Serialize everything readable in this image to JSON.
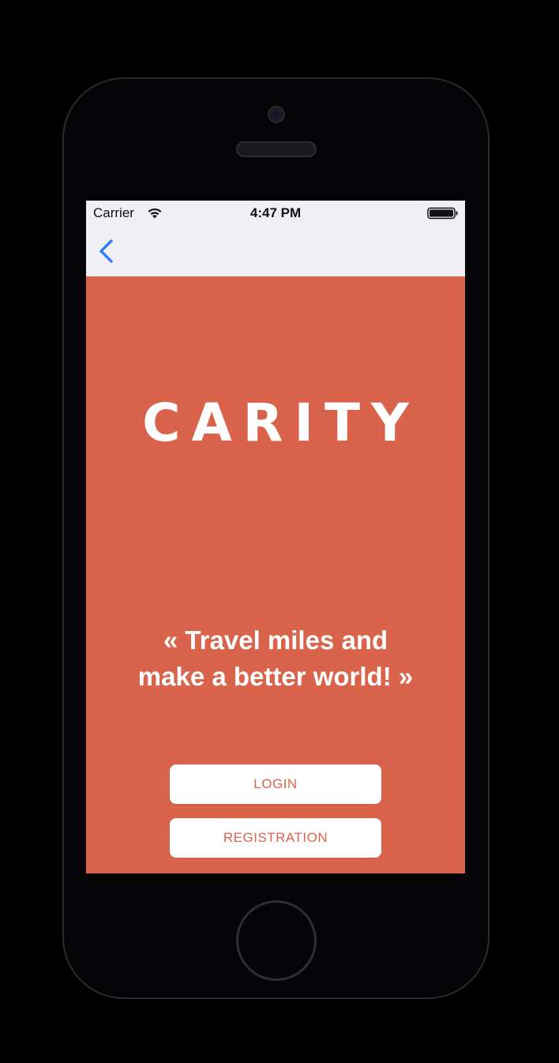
{
  "status_bar": {
    "carrier": "Carrier",
    "time": "4:47 PM"
  },
  "nav": {
    "back_icon": "chevron-left-icon"
  },
  "main": {
    "logo_text": "CARITY",
    "tagline_line1": "« Travel miles and",
    "tagline_line2": "make a better world! »",
    "login_label": "LOGIN",
    "registration_label": "REGISTRATION"
  },
  "colors": {
    "background": "#D9644B",
    "nav_bar": "#EFEFF4",
    "accent_blue": "#2F7CF6",
    "button_text": "#D9644B",
    "button_bg": "#FFFFFF"
  }
}
